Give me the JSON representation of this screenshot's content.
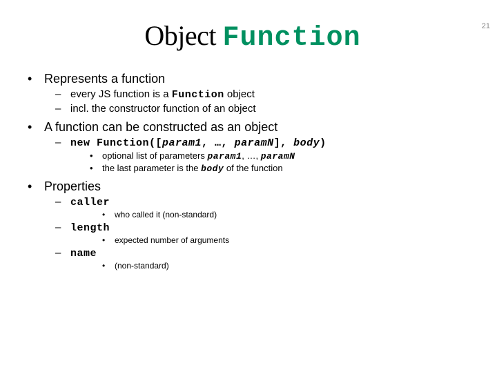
{
  "slide_number": "21",
  "title": {
    "plain": "Object ",
    "code": "Function"
  },
  "b1": {
    "t": "Represents a function",
    "s": [
      {
        "pre": "every JS function is a ",
        "code": "Function",
        "post": " object"
      },
      {
        "pre": "incl. the constructor function of an object",
        "code": "",
        "post": ""
      }
    ]
  },
  "b2": {
    "t": "A function can be constructed as an object",
    "code_line": {
      "c1": "new Function([",
      "p1": "param1",
      "c2": ", …, ",
      "p2": "paramN",
      "c3": "], ",
      "p3": "body",
      "c4": ")"
    },
    "s": [
      {
        "pre": "optional list of parameters ",
        "p1": "param1",
        "mid": ", …, ",
        "p2": "paramN"
      },
      {
        "pre": "the last parameter is the ",
        "p1": "body",
        "post": " of the function"
      }
    ]
  },
  "b3": {
    "t": "Properties",
    "props": [
      {
        "name": "caller",
        "desc": "who called it (non-standard)"
      },
      {
        "name": "length",
        "desc": "expected number of arguments"
      },
      {
        "name": "name",
        "desc": "(non-standard)"
      }
    ]
  }
}
